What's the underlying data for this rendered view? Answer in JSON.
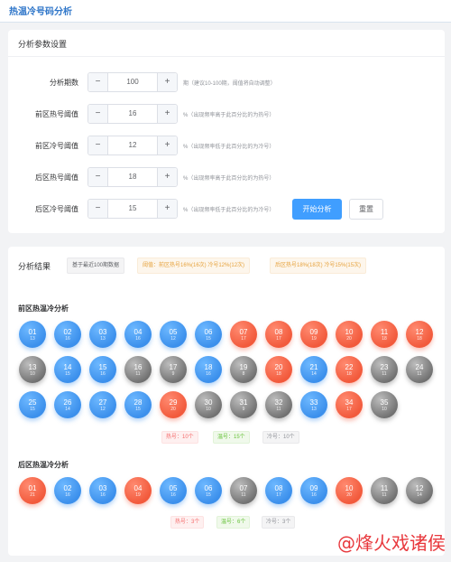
{
  "page": {
    "title": "热温冷号码分析"
  },
  "params": {
    "title": "分析参数设置",
    "rows": [
      {
        "label": "分析期数",
        "value": "100",
        "hint": "期（建议10-100期，阈值将自动调整）"
      },
      {
        "label": "前区热号阈值",
        "value": "16",
        "hint": "%（出现频率高于此百分比的为热号）"
      },
      {
        "label": "前区冷号阈值",
        "value": "12",
        "hint": "%（出现频率低于此百分比的为冷号）"
      },
      {
        "label": "后区热号阈值",
        "value": "18",
        "hint": "%（出现频率高于此百分比的为热号）"
      },
      {
        "label": "后区冷号阈值",
        "value": "15",
        "hint": "%（出现频率低于此百分比的为冷号）"
      }
    ],
    "minus_symbol": "−",
    "plus_symbol": "+",
    "start_button": "开始分析",
    "reset_button": "重置"
  },
  "results": {
    "title": "分析结果",
    "tag_basis": "基于最近100期数据",
    "tag_front": "阈值：前区热号16%(16次) 冷号12%(12次)",
    "tag_back": "后区热号18%(18次) 冷号15%(15次)",
    "front": {
      "title": "前区热温冷分析",
      "balls": [
        {
          "num": "01",
          "count": "13",
          "type": "warm"
        },
        {
          "num": "02",
          "count": "16",
          "type": "warm"
        },
        {
          "num": "03",
          "count": "13",
          "type": "warm"
        },
        {
          "num": "04",
          "count": "16",
          "type": "warm"
        },
        {
          "num": "05",
          "count": "12",
          "type": "warm"
        },
        {
          "num": "06",
          "count": "15",
          "type": "warm"
        },
        {
          "num": "07",
          "count": "17",
          "type": "hot"
        },
        {
          "num": "08",
          "count": "17",
          "type": "hot"
        },
        {
          "num": "09",
          "count": "19",
          "type": "hot"
        },
        {
          "num": "10",
          "count": "20",
          "type": "hot"
        },
        {
          "num": "11",
          "count": "18",
          "type": "hot"
        },
        {
          "num": "12",
          "count": "18",
          "type": "hot"
        },
        {
          "num": "13",
          "count": "10",
          "type": "cold"
        },
        {
          "num": "14",
          "count": "15",
          "type": "warm"
        },
        {
          "num": "15",
          "count": "16",
          "type": "warm"
        },
        {
          "num": "16",
          "count": "11",
          "type": "cold"
        },
        {
          "num": "17",
          "count": "9",
          "type": "cold"
        },
        {
          "num": "18",
          "count": "16",
          "type": "warm"
        },
        {
          "num": "19",
          "count": "8",
          "type": "cold"
        },
        {
          "num": "20",
          "count": "18",
          "type": "hot"
        },
        {
          "num": "21",
          "count": "14",
          "type": "warm"
        },
        {
          "num": "22",
          "count": "18",
          "type": "hot"
        },
        {
          "num": "23",
          "count": "11",
          "type": "cold"
        },
        {
          "num": "24",
          "count": "11",
          "type": "cold"
        },
        {
          "num": "25",
          "count": "15",
          "type": "warm"
        },
        {
          "num": "26",
          "count": "14",
          "type": "warm"
        },
        {
          "num": "27",
          "count": "12",
          "type": "warm"
        },
        {
          "num": "28",
          "count": "15",
          "type": "warm"
        },
        {
          "num": "29",
          "count": "20",
          "type": "hot"
        },
        {
          "num": "30",
          "count": "10",
          "type": "cold"
        },
        {
          "num": "31",
          "count": "9",
          "type": "cold"
        },
        {
          "num": "32",
          "count": "11",
          "type": "cold"
        },
        {
          "num": "33",
          "count": "13",
          "type": "warm"
        },
        {
          "num": "34",
          "count": "17",
          "type": "hot"
        },
        {
          "num": "35",
          "count": "10",
          "type": "cold"
        }
      ],
      "legend": {
        "hot": "热号：10个",
        "warm": "温号：15个",
        "cold": "冷号：10个"
      }
    },
    "back": {
      "title": "后区热温冷分析",
      "balls": [
        {
          "num": "01",
          "count": "21",
          "type": "hot"
        },
        {
          "num": "02",
          "count": "16",
          "type": "warm"
        },
        {
          "num": "03",
          "count": "16",
          "type": "warm"
        },
        {
          "num": "04",
          "count": "19",
          "type": "hot"
        },
        {
          "num": "05",
          "count": "16",
          "type": "warm"
        },
        {
          "num": "06",
          "count": "15",
          "type": "warm"
        },
        {
          "num": "07",
          "count": "11",
          "type": "cold"
        },
        {
          "num": "08",
          "count": "17",
          "type": "warm"
        },
        {
          "num": "09",
          "count": "16",
          "type": "warm"
        },
        {
          "num": "10",
          "count": "20",
          "type": "hot"
        },
        {
          "num": "11",
          "count": "11",
          "type": "cold"
        },
        {
          "num": "12",
          "count": "14",
          "type": "cold"
        }
      ],
      "legend": {
        "hot": "热号：3个",
        "warm": "温号：6个",
        "cold": "冷号：3个"
      }
    }
  },
  "watermark": "@烽火戏诸侯"
}
